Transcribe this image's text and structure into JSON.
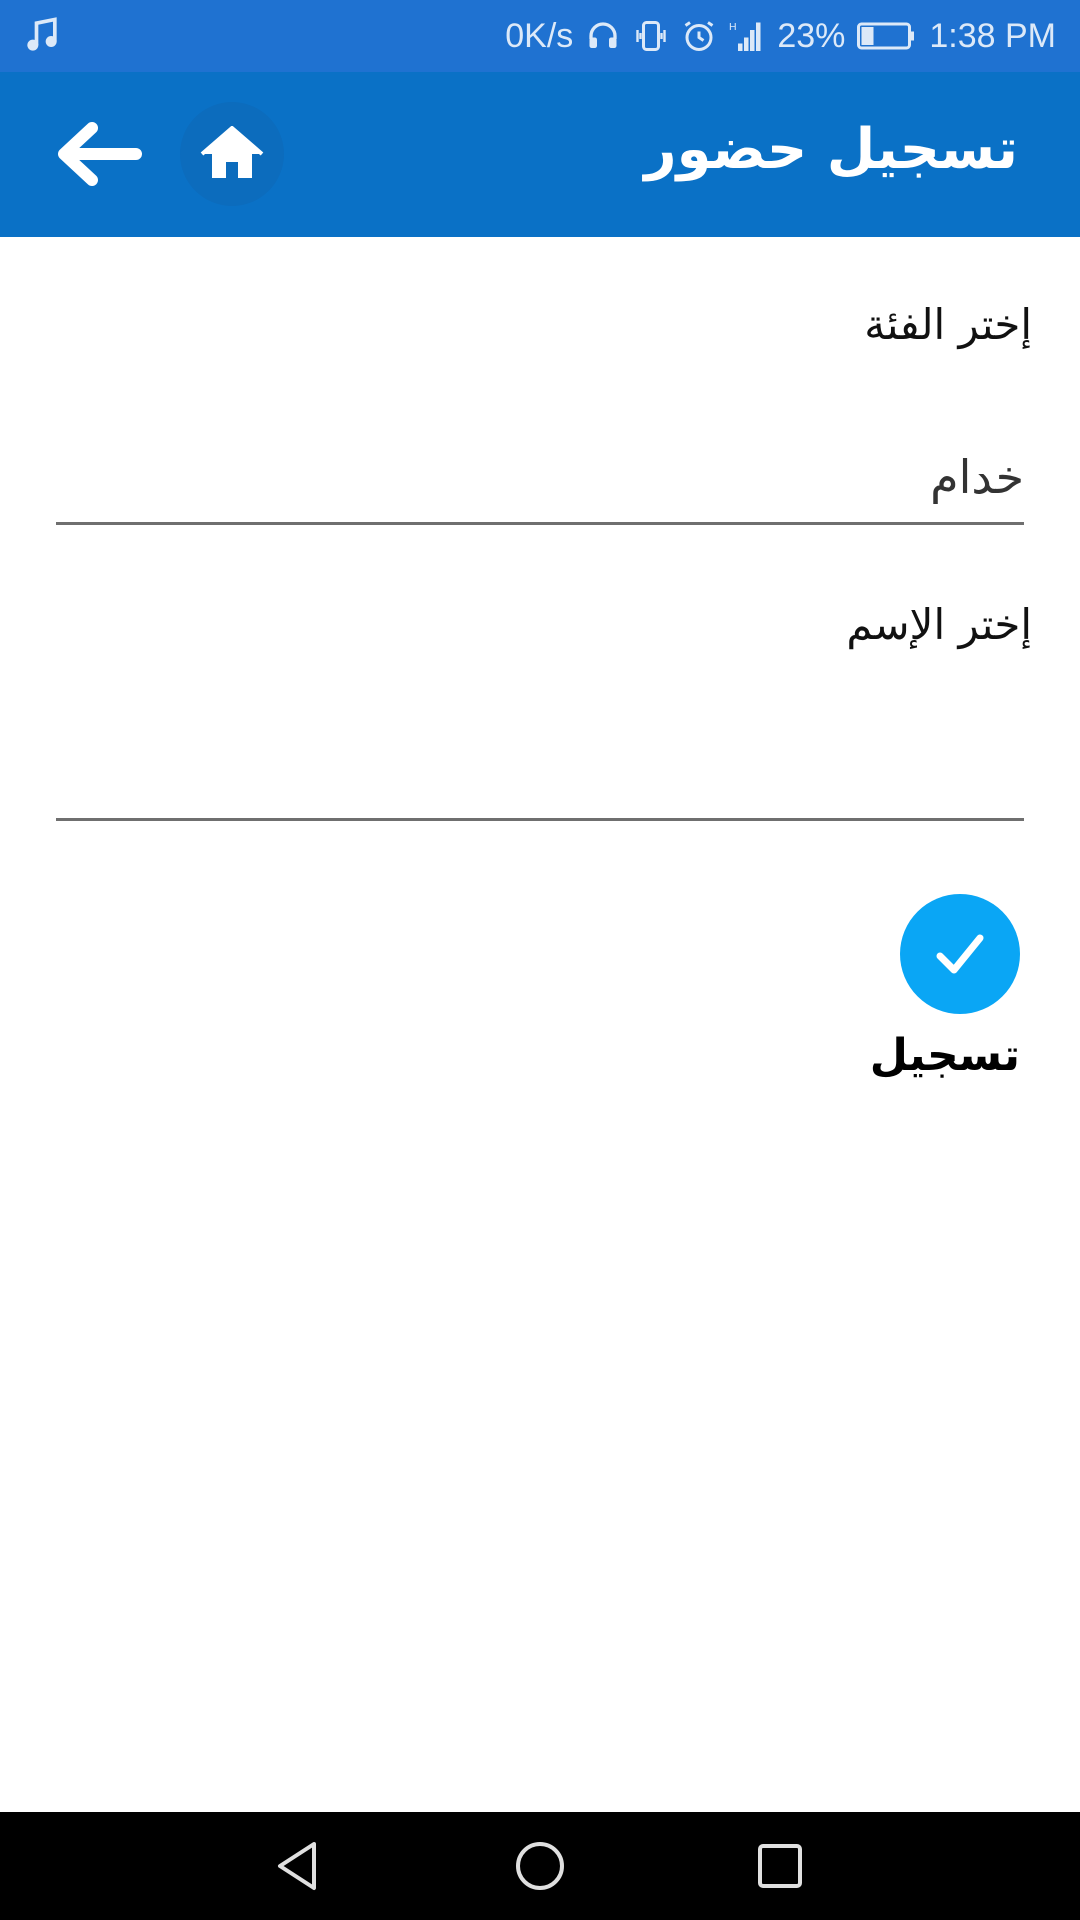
{
  "status_bar": {
    "left_icon": "music-note-icon",
    "net_speed": "0K/s",
    "battery": "23%",
    "time": "1:38 PM",
    "icons": [
      "headset-icon",
      "vibrate-icon",
      "alarm-icon",
      "signal-icon",
      "battery-icon"
    ]
  },
  "app_bar": {
    "title": "تسجيل حضور",
    "back_icon": "arrow-left-icon",
    "home_icon": "home-icon"
  },
  "form": {
    "category_label": "إختر الفئة",
    "category_value": "خدام",
    "name_label": "إختر الإسم",
    "name_value": ""
  },
  "register": {
    "icon": "check-icon",
    "label": "تسجيل",
    "color": "#0aa6f5"
  },
  "nav_bar": {
    "back_icon": "nav-back-icon",
    "home_icon": "nav-home-icon",
    "recents_icon": "nav-recents-icon"
  },
  "colors": {
    "status_bar": "#1f72d1",
    "app_bar": "#0a71c6"
  }
}
